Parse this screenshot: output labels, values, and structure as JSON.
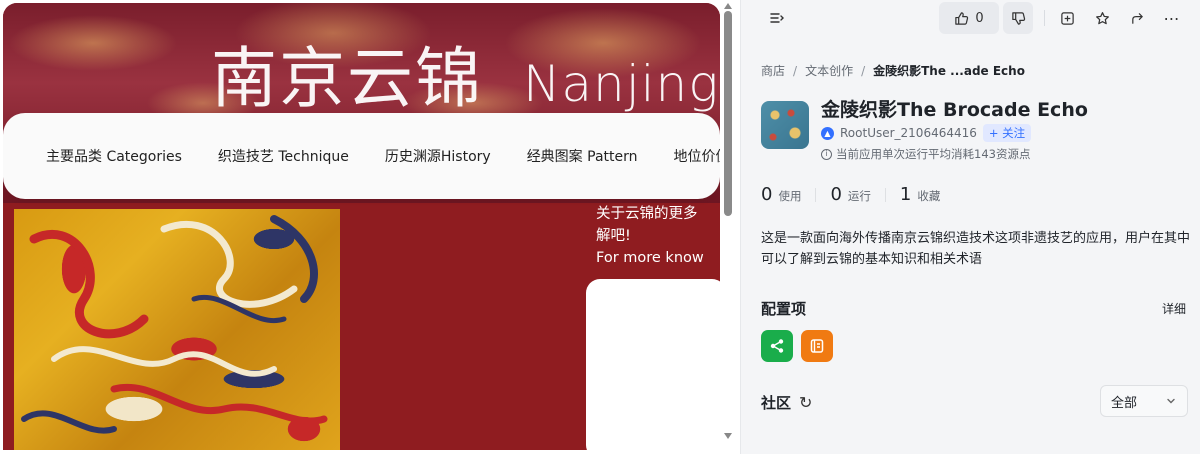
{
  "preview": {
    "hero_title_zh": "南京云锦",
    "hero_title_en": "Nanjing",
    "nav": [
      {
        "label": "主要品类 Categories"
      },
      {
        "label": "织造技艺 Technique"
      },
      {
        "label": "历史渊源History"
      },
      {
        "label": "经典图案 Pattern"
      },
      {
        "label": "地位价值"
      }
    ],
    "side_text_line1": "关于云锦的更多",
    "side_text_line2": "解吧!",
    "side_text_line3": "For more know"
  },
  "toolbar": {
    "like_count": "0"
  },
  "breadcrumb": {
    "items": [
      "商店",
      "文本创作"
    ],
    "current": "金陵织影The ...ade Echo"
  },
  "app": {
    "title": "金陵织影The Brocade Echo",
    "author": "RootUser_2106464416",
    "follow_label": "+ 关注",
    "cost_note": "当前应用单次运行平均消耗143资源点"
  },
  "stats": [
    {
      "num": "0",
      "label": "使用"
    },
    {
      "num": "0",
      "label": "运行"
    },
    {
      "num": "1",
      "label": "收藏"
    }
  ],
  "description": "这是一款面向海外传播南京云锦织造技术这项非遗技艺的应用，用户在其中可以了解到云锦的基本知识和相关术语",
  "config": {
    "title": "配置项",
    "detail_label": "详细",
    "icons": [
      {
        "name": "workflow-icon",
        "color": "#1aad4b"
      },
      {
        "name": "knowledge-icon",
        "color": "#f07a12"
      }
    ]
  },
  "community": {
    "title": "社区",
    "filter_value": "全部"
  }
}
